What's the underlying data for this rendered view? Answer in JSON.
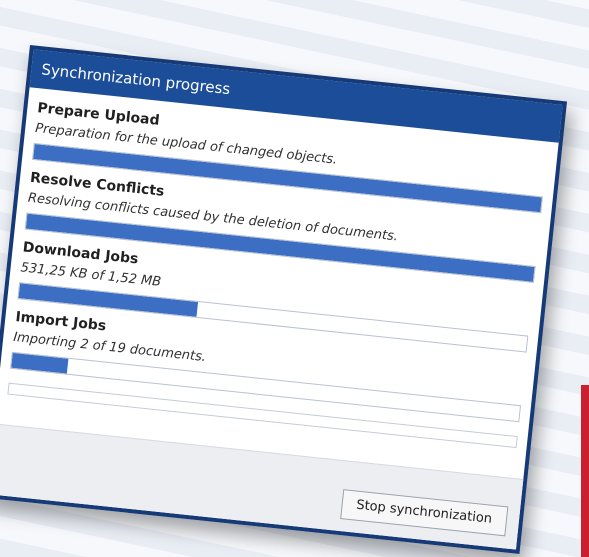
{
  "dialog": {
    "title": "Synchronization progress",
    "steps": [
      {
        "title": "Prepare Upload",
        "description": "Preparation for the upload of changed objects.",
        "progress": 1.0
      },
      {
        "title": "Resolve Conflicts",
        "description": "Resolving conflicts caused by the deletion of documents.",
        "progress": 1.0
      },
      {
        "title": "Download Jobs",
        "description": "531,25 KB of 1,52 MB",
        "progress": 0.35
      },
      {
        "title": "Import Jobs",
        "description": "Importing 2 of 19 documents.",
        "progress": 0.11
      }
    ],
    "stop_button_label": "Stop synchronization"
  },
  "colors": {
    "titlebar": "#1c4d99",
    "progress_fill": "#3c6fc4",
    "accent_red": "#c8202e"
  }
}
